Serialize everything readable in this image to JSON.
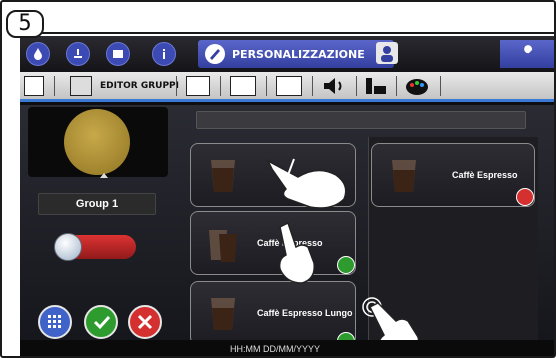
{
  "step": {
    "number": "5"
  },
  "tabbar": {
    "active_label": "PERSONALIZZAZIONE",
    "icons": [
      "drop-icon",
      "clock-icon",
      "cup-icon",
      "info-icon",
      "pen-icon",
      "profile-icon",
      "wrench-icon"
    ]
  },
  "toolbar": {
    "label": "EDITOR GRUPPI",
    "icons": [
      "book-icon",
      "grid-book-icon",
      "book-open-icon",
      "image-icon",
      "film-icon",
      "speaker-icon",
      "cup-hand-icon",
      "palette-icon"
    ]
  },
  "group": {
    "label": "Group 1",
    "toggle_on": false
  },
  "tiles": [
    {
      "name": ""
    },
    {
      "name": "Caffè Espresso"
    },
    {
      "name": "Caffè Espresso Lungo"
    }
  ],
  "assigned": [
    {
      "name": "Caffè Espresso"
    }
  ],
  "footer": {
    "datetime": "HH:MM DD/MM/YYYY"
  },
  "colors": {
    "accent": "#3f4ab5",
    "add": "#2e9b2e",
    "remove": "#d43030",
    "ok": "#2e9b2e",
    "cancel": "#d43030"
  }
}
